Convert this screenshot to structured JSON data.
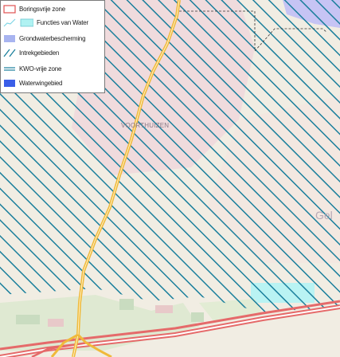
{
  "legend": {
    "items": [
      {
        "label": "Boringsvrije zone",
        "icon": "boringsvrije-zone-swatch"
      },
      {
        "label": "Functies van Water",
        "icon": "functies-van-water-swatch"
      },
      {
        "label": "Grondwaterbescherming",
        "icon": "grondwaterbescherming-swatch"
      },
      {
        "label": "Intrekgebieden",
        "icon": "intrekgebieden-swatch"
      },
      {
        "label": "KWO-vrije zone",
        "icon": "kwo-vrije-zone-swatch"
      },
      {
        "label": "Waterwingebied",
        "icon": "waterwingebied-swatch"
      }
    ]
  },
  "map": {
    "place_label": "VOORTHUIZEN",
    "partial_label": "Gel",
    "colors": {
      "hatch": "#1a7f9c",
      "boringsvrije_zone": "#e05050",
      "functies_van_water": "#b0f2f2",
      "grondwaterbescherming": "#a8b4f0",
      "waterwingebied": "#3a5ee8",
      "road_main": "#e56a6a",
      "road_secondary": "#f0b93a"
    }
  }
}
